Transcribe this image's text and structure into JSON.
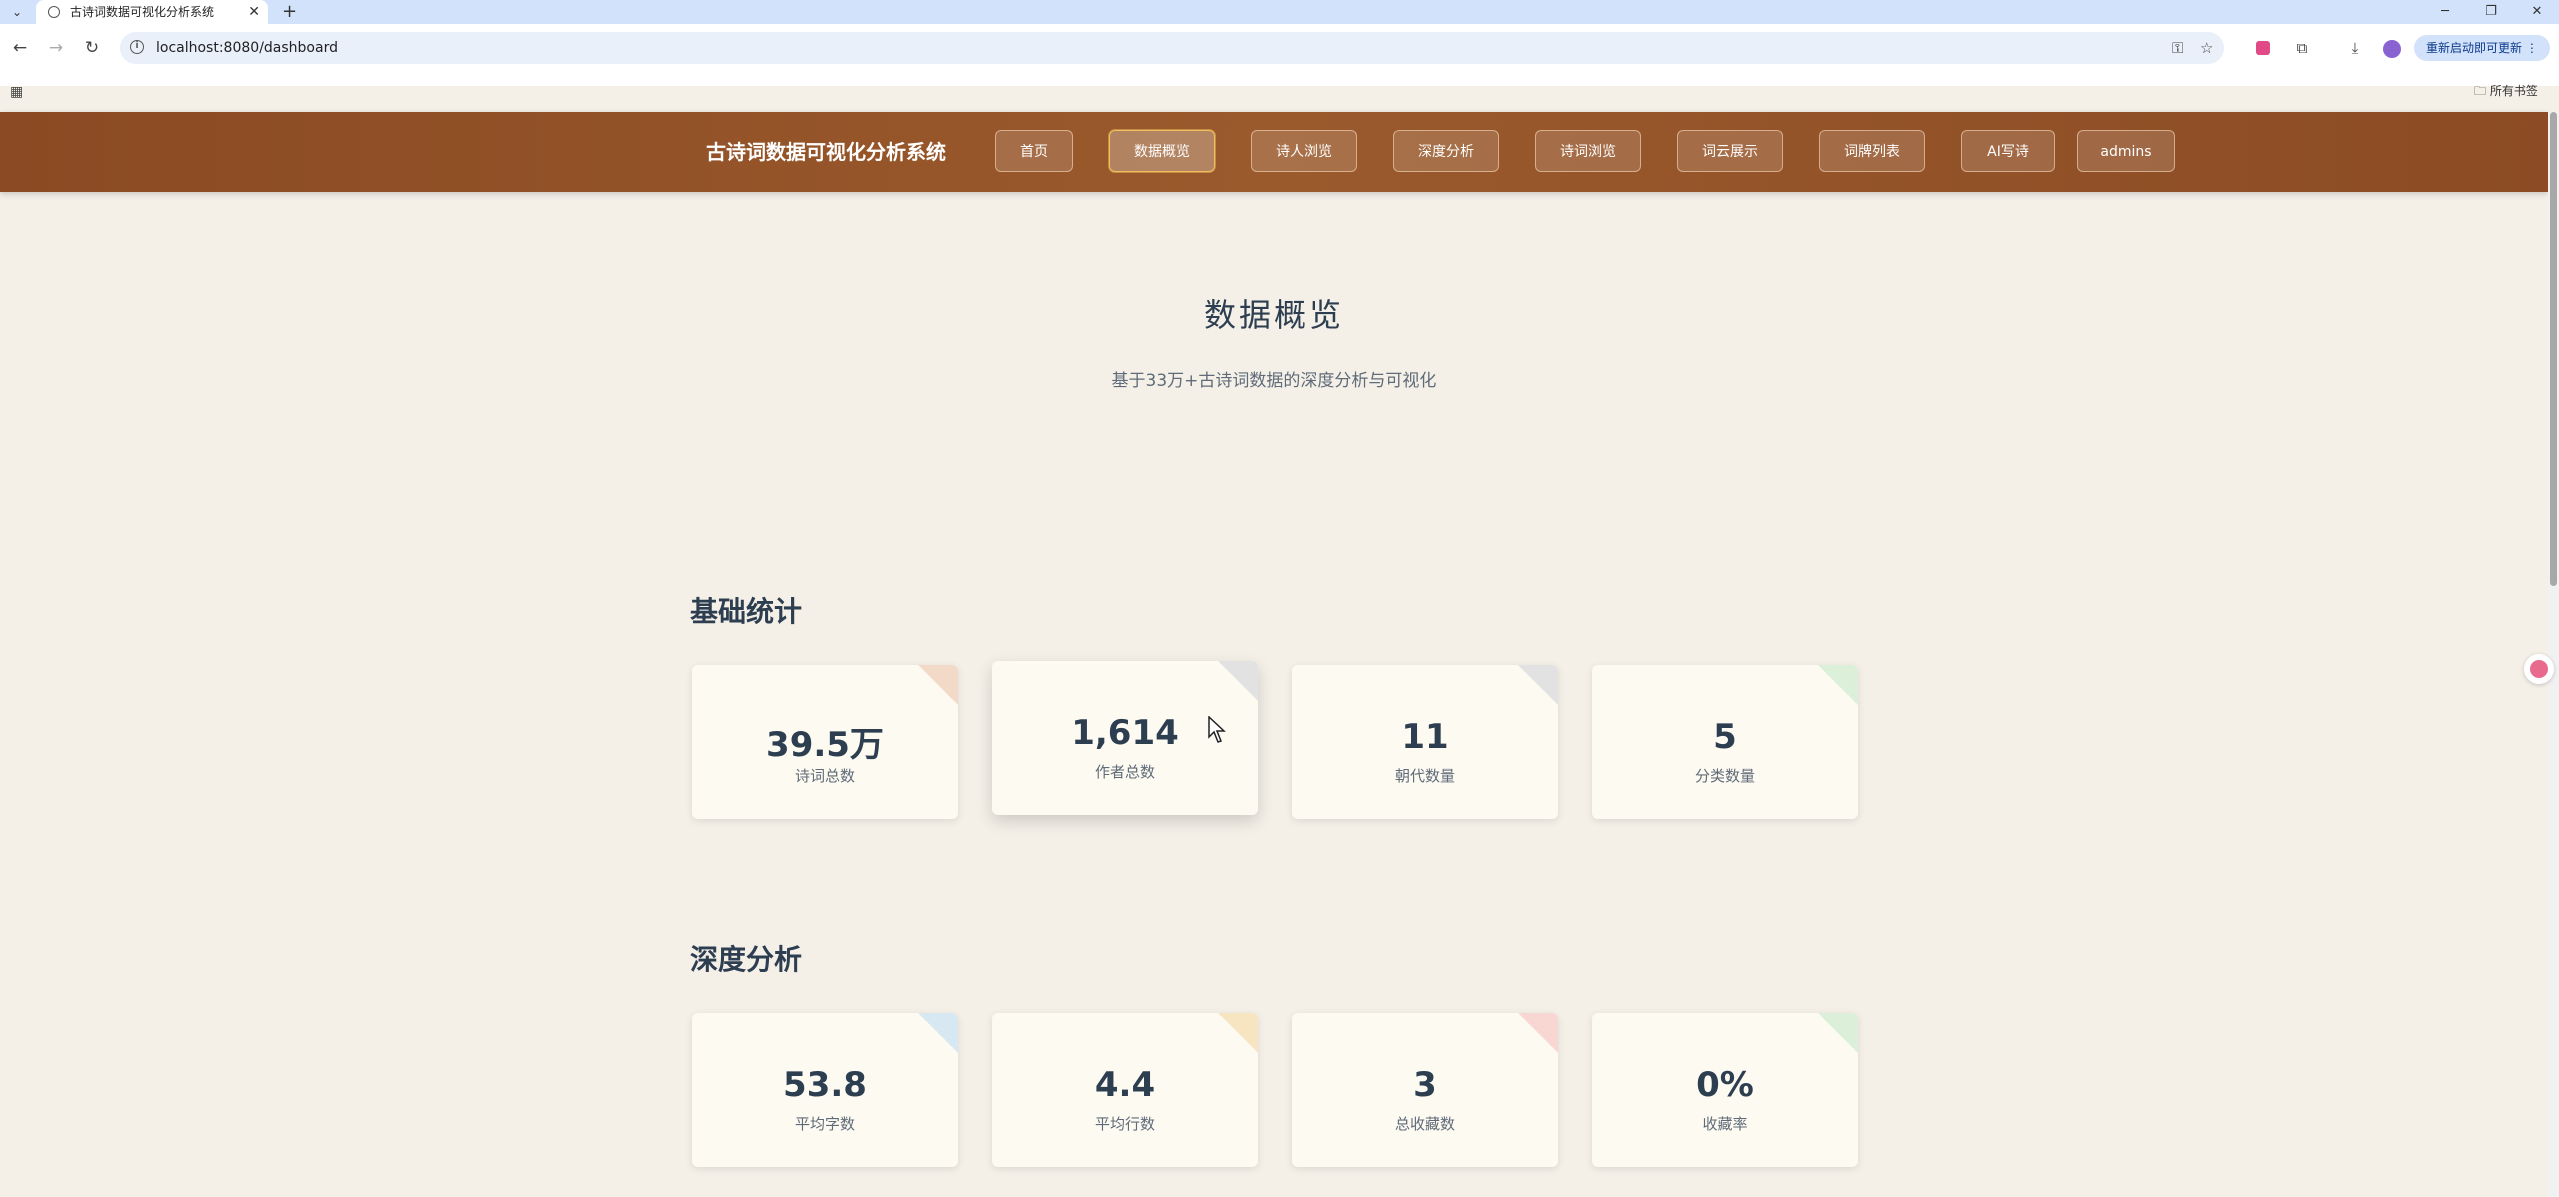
{
  "browser": {
    "tab_title": "古诗词数据可视化分析系统",
    "url": "localhost:8080/dashboard",
    "update_button": "重新启动即可更新",
    "bookmarks_label": "所有书签"
  },
  "header": {
    "brand": "古诗词数据可视化分析系统",
    "nav": [
      {
        "label": "首页"
      },
      {
        "label": "数据概览"
      },
      {
        "label": "诗人浏览"
      },
      {
        "label": "深度分析"
      },
      {
        "label": "诗词浏览"
      },
      {
        "label": "词云展示"
      },
      {
        "label": "词牌列表"
      },
      {
        "label": "AI写诗"
      },
      {
        "label": "admins"
      }
    ],
    "active_nav": "数据概览"
  },
  "main": {
    "title": "数据概览",
    "subtitle": "基于33万+古诗词数据的深度分析与可视化",
    "basic": {
      "title": "基础统计",
      "cards": [
        {
          "value": "39.5万",
          "label": "诗词总数",
          "accent": "#f3d9c8"
        },
        {
          "value": "1,614",
          "label": "作者总数",
          "accent": "#e2e2e2"
        },
        {
          "value": "11",
          "label": "朝代数量",
          "accent": "#e2e2e2"
        },
        {
          "value": "5",
          "label": "分类数量",
          "accent": "#dcefd9"
        }
      ]
    },
    "deep": {
      "title": "深度分析",
      "cards": [
        {
          "value": "53.8",
          "label": "平均字数",
          "accent": "#d8e8f2"
        },
        {
          "value": "4.4",
          "label": "平均行数",
          "accent": "#f7e4c0"
        },
        {
          "value": "3",
          "label": "总收藏数",
          "accent": "#f8d6d2"
        },
        {
          "value": "0%",
          "label": "收藏率",
          "accent": "#dcefd9"
        }
      ]
    }
  }
}
